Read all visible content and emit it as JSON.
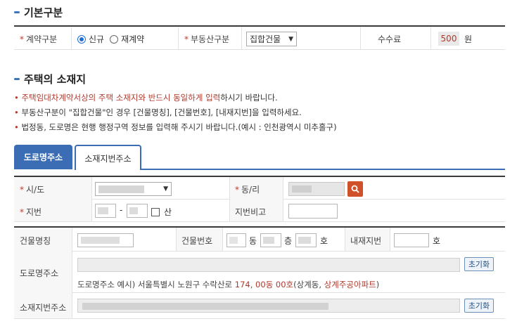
{
  "basic": {
    "title": "기본구분",
    "contract_type_label": "계약구분",
    "option_new": "신규",
    "option_renew": "재계약",
    "property_type_label": "부동산구분",
    "property_type_value": "집합건물",
    "fee_label": "수수료",
    "fee_value": "500",
    "fee_unit": "원"
  },
  "location": {
    "title": "주택의 소재지",
    "note1_red": "주택임대차계약서상의 주택 소재지와 반드시 동일하게 입력",
    "note1_rest": "하시기 바랍니다.",
    "note2": "부동산구분이 \"집합건물\"인 경우 [건물명칭], [건물번호], [내재지번]을 입력하세요.",
    "note3": "법정동, 도로명은 현행 행정구역 정보를 입력해 주시기 바랍니다.(예시 : 인천광역시 미추홀구)"
  },
  "tabs": [
    {
      "label": "도로명주소"
    },
    {
      "label": "소재지번주소"
    }
  ],
  "form": {
    "sido_label": "시/도",
    "dongri_label": "동/리",
    "jibun_label": "지번",
    "jibun_dash": "-",
    "san_label": "산",
    "jibun_remark_label": "지번비고"
  },
  "building": {
    "name_label": "건물명칭",
    "number_label": "건물번호",
    "dong_unit": "동",
    "floor_unit": "층",
    "ho_unit": "호",
    "inner_jibun_label": "내재지번",
    "inner_ho_unit": "호",
    "road_addr_label": "도로명주소",
    "reset_label": "초기화",
    "example_prefix": "도로명주소 예시) 서울특별시 노원구 수락산로 ",
    "example_highlight": "174, 00동 00호",
    "example_middle": "(상계동, ",
    "example_highlight2": "상계주공아파트",
    "example_suffix": ")",
    "jibun_addr_label": "소재지번주소"
  },
  "colors": {
    "accent_blue": "#3a77bd",
    "tab_active": "#3a6db3",
    "required_red": "#c0392b",
    "search_btn": "#d0502a"
  }
}
